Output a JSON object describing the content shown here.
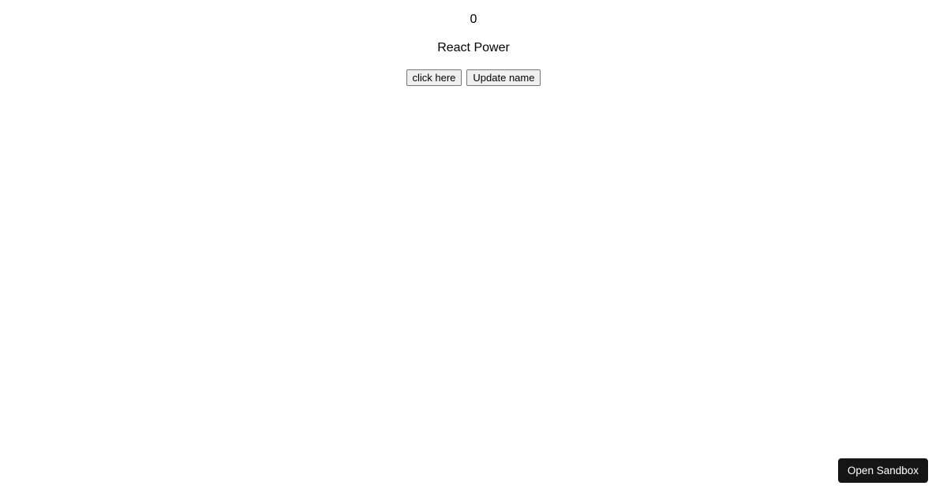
{
  "main": {
    "counter_value": "0",
    "title": "React Power",
    "buttons": {
      "click_here": "click here",
      "update_name": "Update name"
    }
  },
  "footer": {
    "open_sandbox": "Open Sandbox"
  }
}
